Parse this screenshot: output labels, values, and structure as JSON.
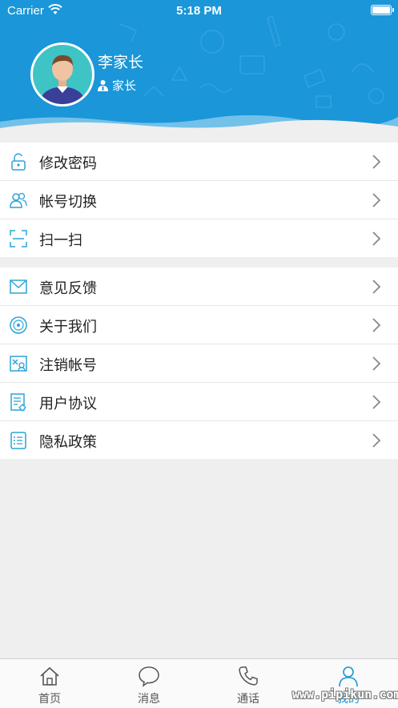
{
  "status_bar": {
    "carrier": "Carrier",
    "time": "5:18 PM"
  },
  "profile": {
    "name": "李家长",
    "role": "家长"
  },
  "menu_group_1": [
    {
      "label": "修改密码",
      "icon": "lock-icon"
    },
    {
      "label": "帐号切换",
      "icon": "switch-account-icon"
    },
    {
      "label": "扫一扫",
      "icon": "scan-icon"
    }
  ],
  "menu_group_2": [
    {
      "label": "意见反馈",
      "icon": "mail-icon"
    },
    {
      "label": "关于我们",
      "icon": "disc-icon"
    },
    {
      "label": "注销帐号",
      "icon": "cancel-account-icon"
    },
    {
      "label": "用户协议",
      "icon": "agreement-icon"
    },
    {
      "label": "隐私政策",
      "icon": "privacy-list-icon"
    }
  ],
  "tabbar": {
    "tabs": [
      {
        "label": "首页",
        "icon": "home-icon"
      },
      {
        "label": "消息",
        "icon": "message-icon"
      },
      {
        "label": "通话",
        "icon": "phone-icon"
      },
      {
        "label": "我的",
        "icon": "profile-icon"
      }
    ],
    "active_index": 3
  },
  "watermark": "www.pipikun.com",
  "colors": {
    "accent": "#1a96d9",
    "background": "#efefef",
    "icon": "#2ba3d7"
  }
}
